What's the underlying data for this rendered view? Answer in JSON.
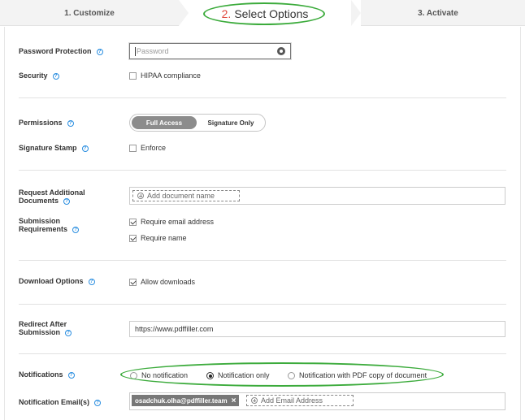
{
  "steps": {
    "step1": "1. Customize",
    "step2_num": "2.",
    "step2_label": "Select Options",
    "step3": "3. Activate"
  },
  "password": {
    "label": "Password Protection",
    "placeholder": "Password"
  },
  "security": {
    "label": "Security",
    "hipaa_label": "HIPAA compliance",
    "hipaa_checked": false
  },
  "permissions": {
    "label": "Permissions",
    "options": [
      "Full Access",
      "Signature Only"
    ],
    "selected": "Full Access"
  },
  "signature_stamp": {
    "label": "Signature Stamp",
    "enforce_label": "Enforce",
    "enforce_checked": false
  },
  "request_docs": {
    "label_line1": "Request Additional",
    "label_line2": "Documents",
    "add_placeholder": "Add document name"
  },
  "submission": {
    "label_line1": "Submission",
    "label_line2": "Requirements",
    "require_email": "Require email address",
    "require_name": "Require name"
  },
  "download": {
    "label": "Download Options",
    "allow_label": "Allow downloads"
  },
  "redirect": {
    "label_line1": "Redirect After",
    "label_line2": "Submission",
    "url": "https://www.pdffiller.com"
  },
  "notifications": {
    "label": "Notifications",
    "options": [
      "No notification",
      "Notification only",
      "Notification with PDF copy of document"
    ],
    "selected": "Notification only"
  },
  "notification_emails": {
    "label": "Notification Email(s)",
    "email_tag": "osadchuk.olha@pdffiller.team",
    "add_placeholder": "Add Email Address"
  },
  "colors": {
    "highlight": "#3cab3c",
    "help_icon": "#2a8ee0",
    "step_number": "#e0453b"
  }
}
